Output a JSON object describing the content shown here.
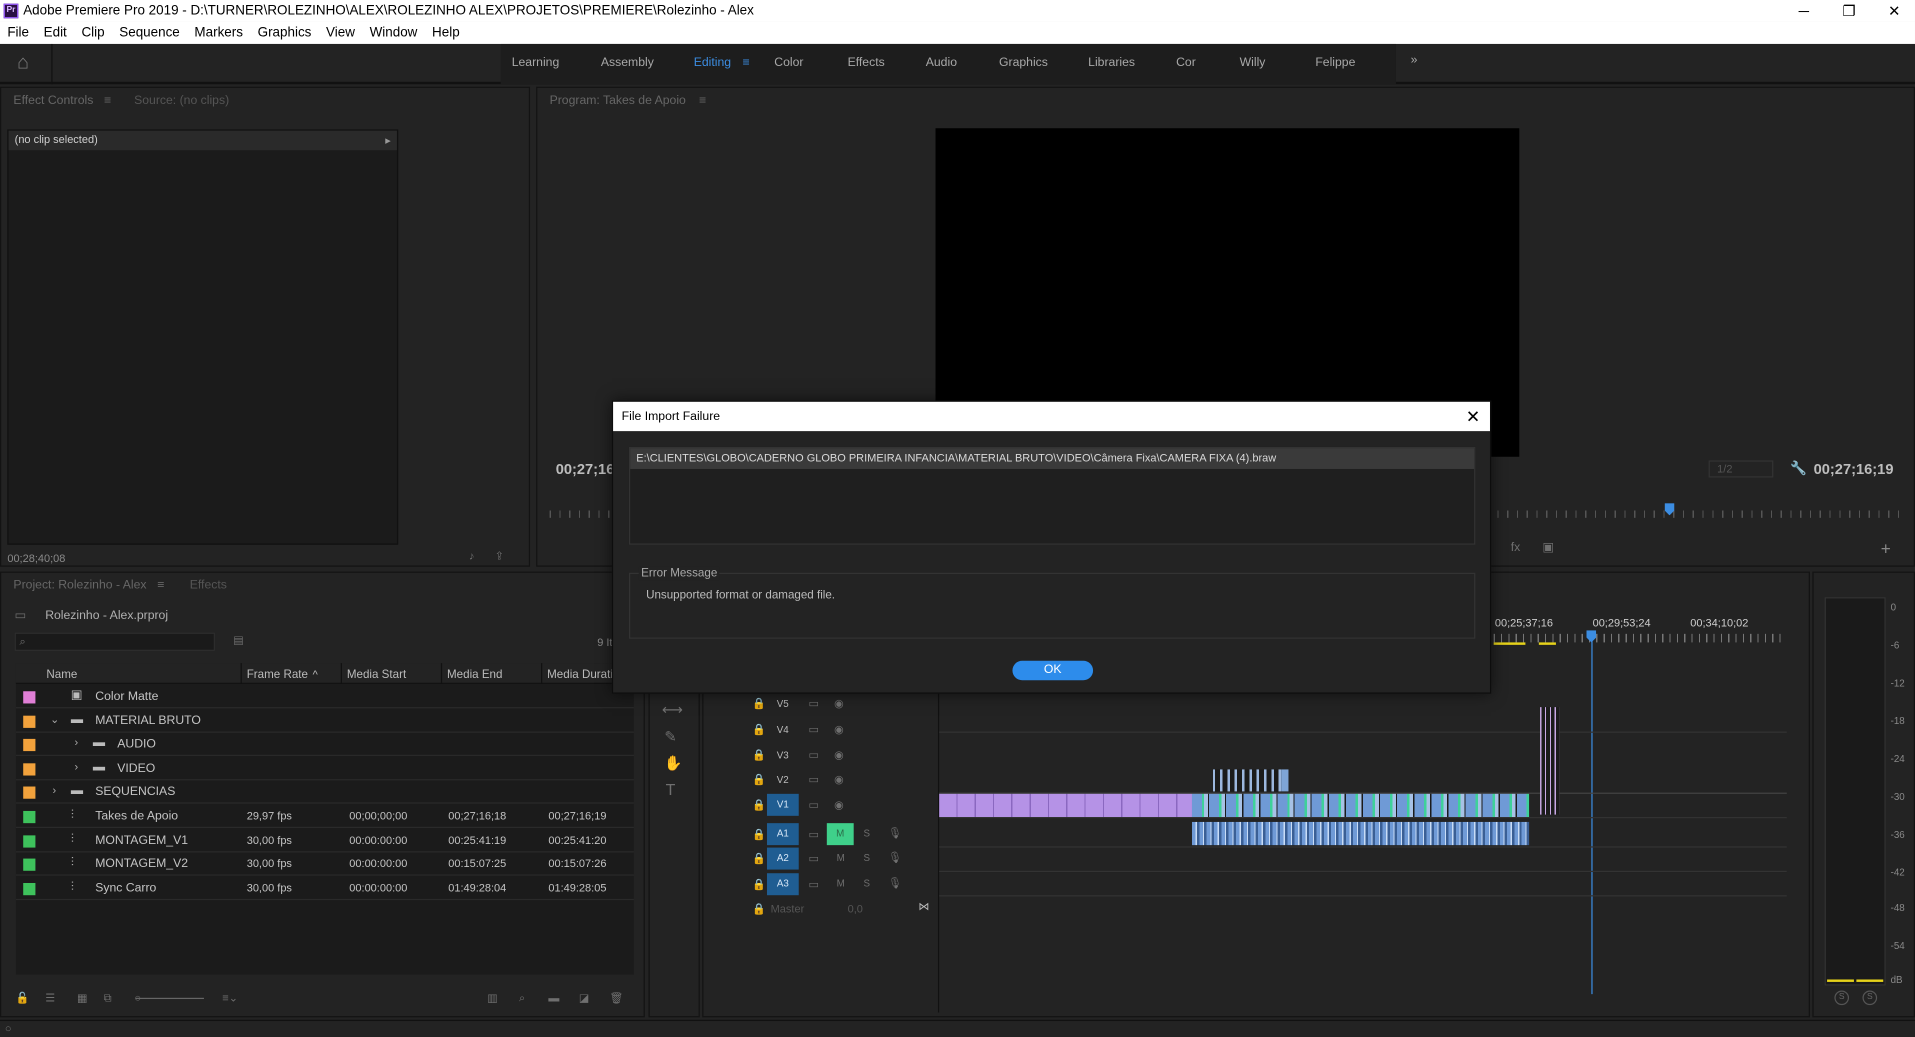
{
  "app": {
    "title": "Adobe Premiere Pro 2019 - D:\\TURNER\\ROLEZINHO\\ALEX\\ROLEZINHO ALEX\\PROJETOS\\PREMIERE\\Rolezinho - Alex",
    "logo": "Pr"
  },
  "window": {
    "minimize": "─",
    "restore": "❐",
    "close": "✕"
  },
  "menu": [
    "File",
    "Edit",
    "Clip",
    "Sequence",
    "Markers",
    "Graphics",
    "View",
    "Window",
    "Help"
  ],
  "workspaces": [
    "Learning",
    "Assembly",
    "Editing",
    "Color",
    "Effects",
    "Audio",
    "Graphics",
    "Libraries",
    "Cor",
    "Willy",
    "Felippe"
  ],
  "workspace_active": "Editing",
  "effect_controls": {
    "tab": "Effect Controls",
    "source_tab": "Source: (no clips)",
    "no_clip": "(no clip selected)",
    "timecode": "00;28;40;08"
  },
  "program": {
    "title": "Program: Takes de Apoio",
    "tc_left": "00;27;16",
    "tc_right": "00;27;16;19",
    "zoom": "1/2"
  },
  "project": {
    "tab": "Project: Rolezinho - Alex",
    "effects_tab": "Effects",
    "file": "Rolezinho - Alex.prproj",
    "items_count": "9 It",
    "columns": [
      "Name",
      "Frame Rate",
      "Media Start",
      "Media End",
      "Media Durati"
    ],
    "rows": [
      {
        "name": "Color Matte",
        "color": "#e07fd6",
        "fr": "",
        "ms": "",
        "me": "",
        "md": "",
        "indent": 0,
        "kind": "matte"
      },
      {
        "name": "MATERIAL BRUTO",
        "color": "#f2a23c",
        "fr": "",
        "ms": "",
        "me": "",
        "md": "",
        "indent": 0,
        "kind": "folder-open"
      },
      {
        "name": "AUDIO",
        "color": "#f2a23c",
        "fr": "",
        "ms": "",
        "me": "",
        "md": "",
        "indent": 1,
        "kind": "folder"
      },
      {
        "name": "VIDEO",
        "color": "#f2a23c",
        "fr": "",
        "ms": "",
        "me": "",
        "md": "",
        "indent": 1,
        "kind": "folder"
      },
      {
        "name": "SEQUENCIAS",
        "color": "#f2a23c",
        "fr": "",
        "ms": "",
        "me": "",
        "md": "",
        "indent": 0,
        "kind": "folder"
      },
      {
        "name": "Takes de Apoio",
        "color": "#3ec25c",
        "fr": "29,97 fps",
        "ms": "00;00;00;00",
        "me": "00;27;16;18",
        "md": "00;27;16;19",
        "indent": 0,
        "kind": "seq"
      },
      {
        "name": "MONTAGEM_V1",
        "color": "#3ec25c",
        "fr": "30,00 fps",
        "ms": "00:00:00:00",
        "me": "00:25:41:19",
        "md": "00:25:41:20",
        "indent": 0,
        "kind": "seq"
      },
      {
        "name": "MONTAGEM_V2",
        "color": "#3ec25c",
        "fr": "30,00 fps",
        "ms": "00:00:00:00",
        "me": "00:15:07:25",
        "md": "00:15:07:26",
        "indent": 0,
        "kind": "seq"
      },
      {
        "name": "Sync Carro",
        "color": "#3ec25c",
        "fr": "30,00 fps",
        "ms": "00:00:00:00",
        "me": "01:49:28:04",
        "md": "01:49:28:05",
        "indent": 0,
        "kind": "seq"
      }
    ]
  },
  "timeline": {
    "ruler": [
      "00;25;37;16",
      "00;29;53;24",
      "00;34;10;02"
    ],
    "video_tracks": [
      "V5",
      "V4",
      "V3",
      "V2",
      "V1"
    ],
    "audio_tracks": [
      "A1",
      "A2",
      "A3"
    ],
    "master": "Master",
    "master_val": "0,0",
    "mute": "M",
    "solo": "S"
  },
  "meter": {
    "labels": [
      "0",
      "-6",
      "-12",
      "-18",
      "-24",
      "-30",
      "-36",
      "-42",
      "-48",
      "-54",
      "dB"
    ],
    "s1": "S",
    "s2": "S"
  },
  "dialog": {
    "title": "File Import Failure",
    "path": "E:\\CLIENTES\\GLOBO\\CADERNO GLOBO PRIMEIRA INFANCIA\\MATERIAL BRUTO\\VIDEO\\Câmera Fixa\\CAMERA FIXA  (4).braw",
    "error_label": "Error Message",
    "error_text": "Unsupported format or damaged file.",
    "ok": "OK"
  }
}
